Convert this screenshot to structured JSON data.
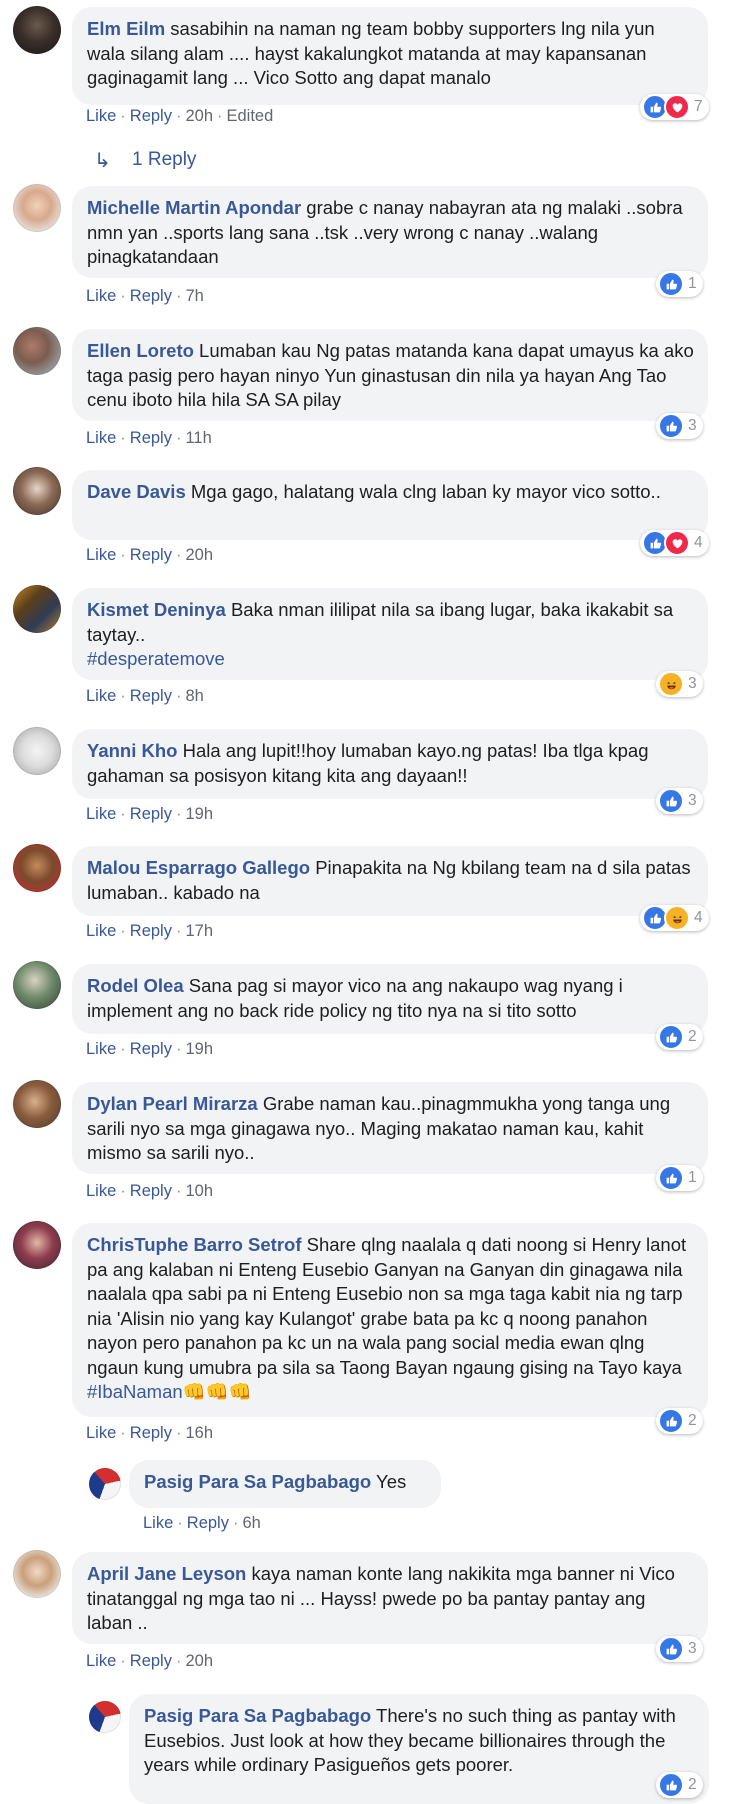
{
  "meta_labels": {
    "like": "Like",
    "reply": "Reply",
    "sep": "·"
  },
  "colors": {
    "link": "#385898",
    "like": "#3578e5",
    "love": "#f0284a",
    "haha": "#f7b125",
    "bubble": "#f2f3f5"
  },
  "c1": {
    "name": "Elm Eilm",
    "text": "sasabihin na naman ng team bobby supporters lng nila yun wala silang alam .... hayst kakalungkot matanda at may kapansanan gaginagamit lang ... Vico Sotto ang dapat manalo",
    "time": "20h",
    "edited": "Edited",
    "count": "7",
    "replies_link": "1 Reply"
  },
  "c2": {
    "name": "Michelle Martin Apondar",
    "text": "grabe c nanay nabayran ata ng malaki ..sobra nmn yan ..sports lang sana ..tsk ..very wrong c nanay ..walang pinagkatandaan",
    "time": "7h",
    "count": "1"
  },
  "c3": {
    "name": "Ellen Loreto",
    "text": "Lumaban kau Ng patas matanda kana dapat umayus ka ako taga pasig pero hayan ninyo Yun ginastusan din nila ya hayan Ang Tao cenu iboto hila hila SA SA pilay",
    "time": "11h",
    "count": "3"
  },
  "c4": {
    "name": "Dave Davis",
    "text": "Mga gago, halatang wala clng laban ky mayor vico sotto..",
    "time": "20h",
    "count": "4"
  },
  "c5": {
    "name": "Kismet Deninya",
    "text": "Baka nman ililipat nila sa ibang lugar, baka ikakabit sa taytay..",
    "hashtag": "#desperatemove",
    "time": "8h",
    "count": "3"
  },
  "c6": {
    "name": "Yanni Kho",
    "text": "Hala ang lupit!!hoy lumaban kayo.ng patas! Iba tlga kpag gahaman sa posisyon kitang kita ang dayaan!!",
    "time": "19h",
    "count": "3"
  },
  "c7": {
    "name": "Malou Esparrago Gallego",
    "text": "Pinapakita na Ng kbilang team na d sila patas lumaban.. kabado na",
    "time": "17h",
    "count": "4"
  },
  "c8": {
    "name": "Rodel Olea",
    "text": "Sana pag si mayor vico na ang nakaupo wag nyang i implement ang no back ride policy ng tito nya na si tito sotto",
    "time": "19h",
    "count": "2"
  },
  "c9": {
    "name": "Dylan Pearl Mirarza",
    "text": "Grabe naman kau..pinagmmukha yong tanga ung sarili nyo sa mga ginagawa nyo.. Maging makatao naman kau, kahit mismo sa sarili nyo..",
    "time": "10h",
    "count": "1"
  },
  "c10": {
    "name": "ChrisTuphe Barro Setrof",
    "text": "Share qlng naalala q dati noong si Henry lanot pa ang kalaban ni Enteng Eusebio Ganyan na Ganyan din ginagawa nila naalala qpa sabi pa ni Enteng Eusebio non sa mga taga kabit nia ng tarp nia 'Alisin nio yang kay Kulangot' grabe bata pa kc q noong panahon nayon pero panahon pa kc un na wala pang social media ewan qlng ngaun kung umubra pa sila sa Taong Bayan ngaung gising na Tayo kaya",
    "hashtag": "#IbaNaman",
    "emoji": "👊👊👊",
    "time": "16h",
    "count": "2"
  },
  "r10": {
    "name": "Pasig Para Sa Pagbabago",
    "text": "Yes",
    "time": "6h"
  },
  "c11": {
    "name": "April Jane Leyson",
    "text": "kaya naman konte lang nakikita mga banner ni Vico tinatanggal ng mga tao ni ... Hayss! pwede po ba pantay pantay ang laban ..",
    "time": "20h",
    "count": "3"
  },
  "r11": {
    "name": "Pasig Para Sa Pagbabago",
    "text": "There's no such thing as pantay with Eusebios. Just look at how they became billionaires through the years while ordinary Pasigueños gets poorer.",
    "count": "2"
  }
}
